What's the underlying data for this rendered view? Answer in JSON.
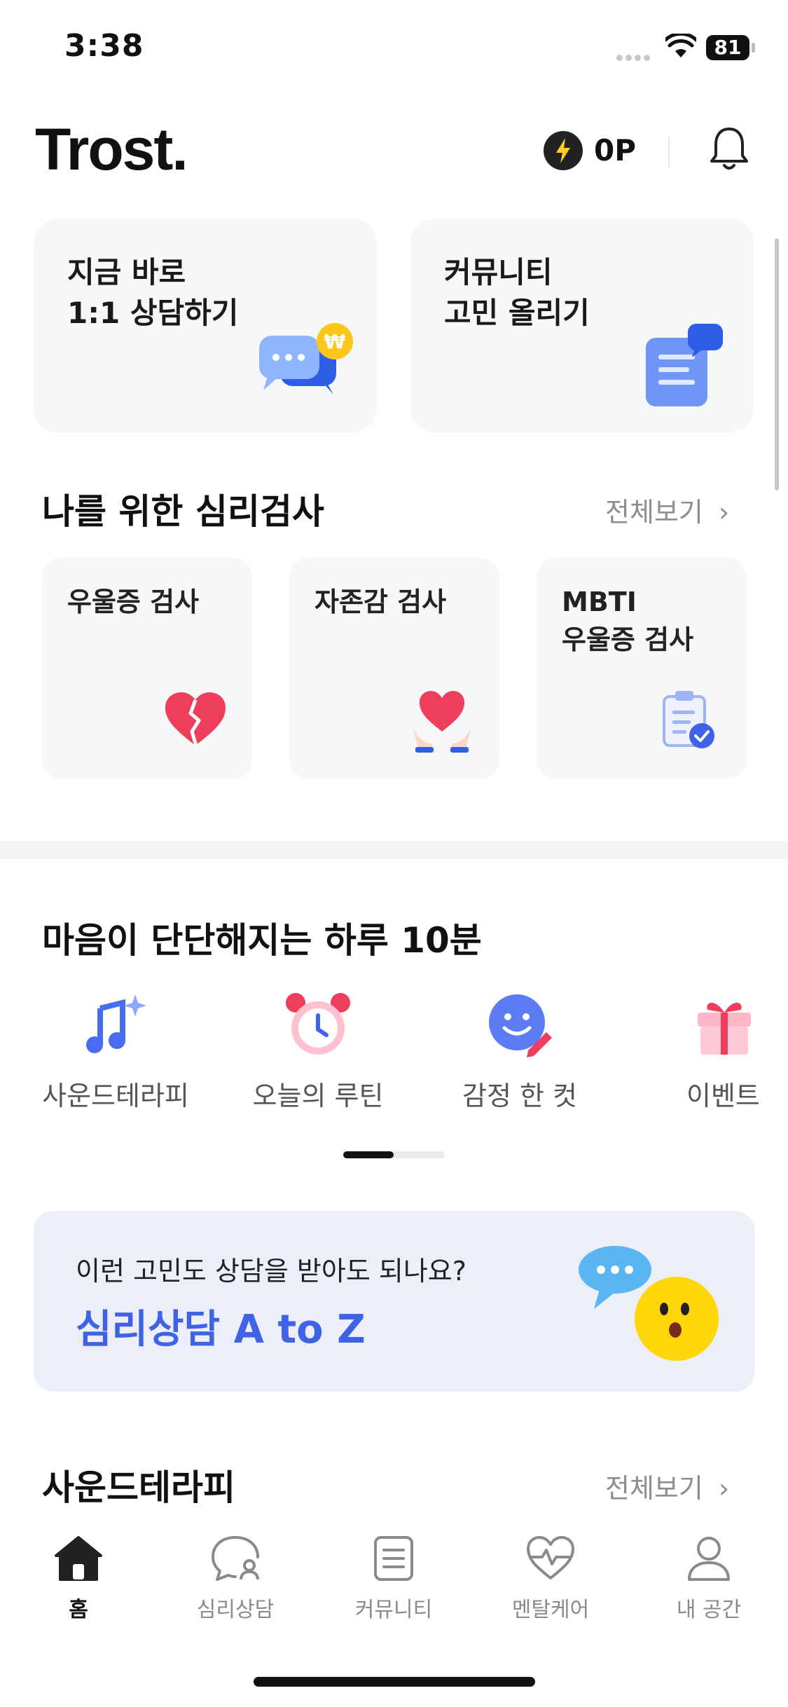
{
  "status_bar": {
    "time": "3:38",
    "battery": "81"
  },
  "header": {
    "logo": "Trost.",
    "points": "0P"
  },
  "main_cards": [
    {
      "line1": "지금 바로",
      "line2": "1:1 상담하기"
    },
    {
      "line1": "커뮤니티",
      "line2": "고민 올리기"
    }
  ],
  "tests_section": {
    "title": "나를 위한 심리검사",
    "see_all": "전체보기",
    "items": [
      {
        "line1": "우울증 검사",
        "line2": ""
      },
      {
        "line1": "자존감 검사",
        "line2": ""
      },
      {
        "line1": "MBTI",
        "line2": "우울증 검사"
      }
    ]
  },
  "daily_section": {
    "title": "마음이 단단해지는 하루 10분",
    "items": [
      {
        "label": "사운드테라피",
        "icon": "music-notes-icon"
      },
      {
        "label": "오늘의 루틴",
        "icon": "alarm-clock-icon"
      },
      {
        "label": "감정 한 컷",
        "icon": "smiley-pencil-icon"
      },
      {
        "label": "이벤트",
        "icon": "gift-icon"
      }
    ]
  },
  "banner": {
    "subtitle": "이런 고민도 상담을 받아도 되나요?",
    "title": "심리상담 A to Z"
  },
  "sound_section": {
    "title": "사운드테라피",
    "see_all": "전체보기"
  },
  "bottom_nav": [
    {
      "label": "홈",
      "icon": "home-icon",
      "active": true
    },
    {
      "label": "심리상담",
      "icon": "counsel-chat-icon",
      "active": false
    },
    {
      "label": "커뮤니티",
      "icon": "document-icon",
      "active": false
    },
    {
      "label": "멘탈케어",
      "icon": "heart-pulse-icon",
      "active": false
    },
    {
      "label": "내 공간",
      "icon": "person-icon",
      "active": false
    }
  ],
  "colors": {
    "accent": "#3f63e6",
    "card_bg": "#f6f7f9",
    "banner_bg": "#eceefa",
    "heart": "#ef3e5c"
  }
}
